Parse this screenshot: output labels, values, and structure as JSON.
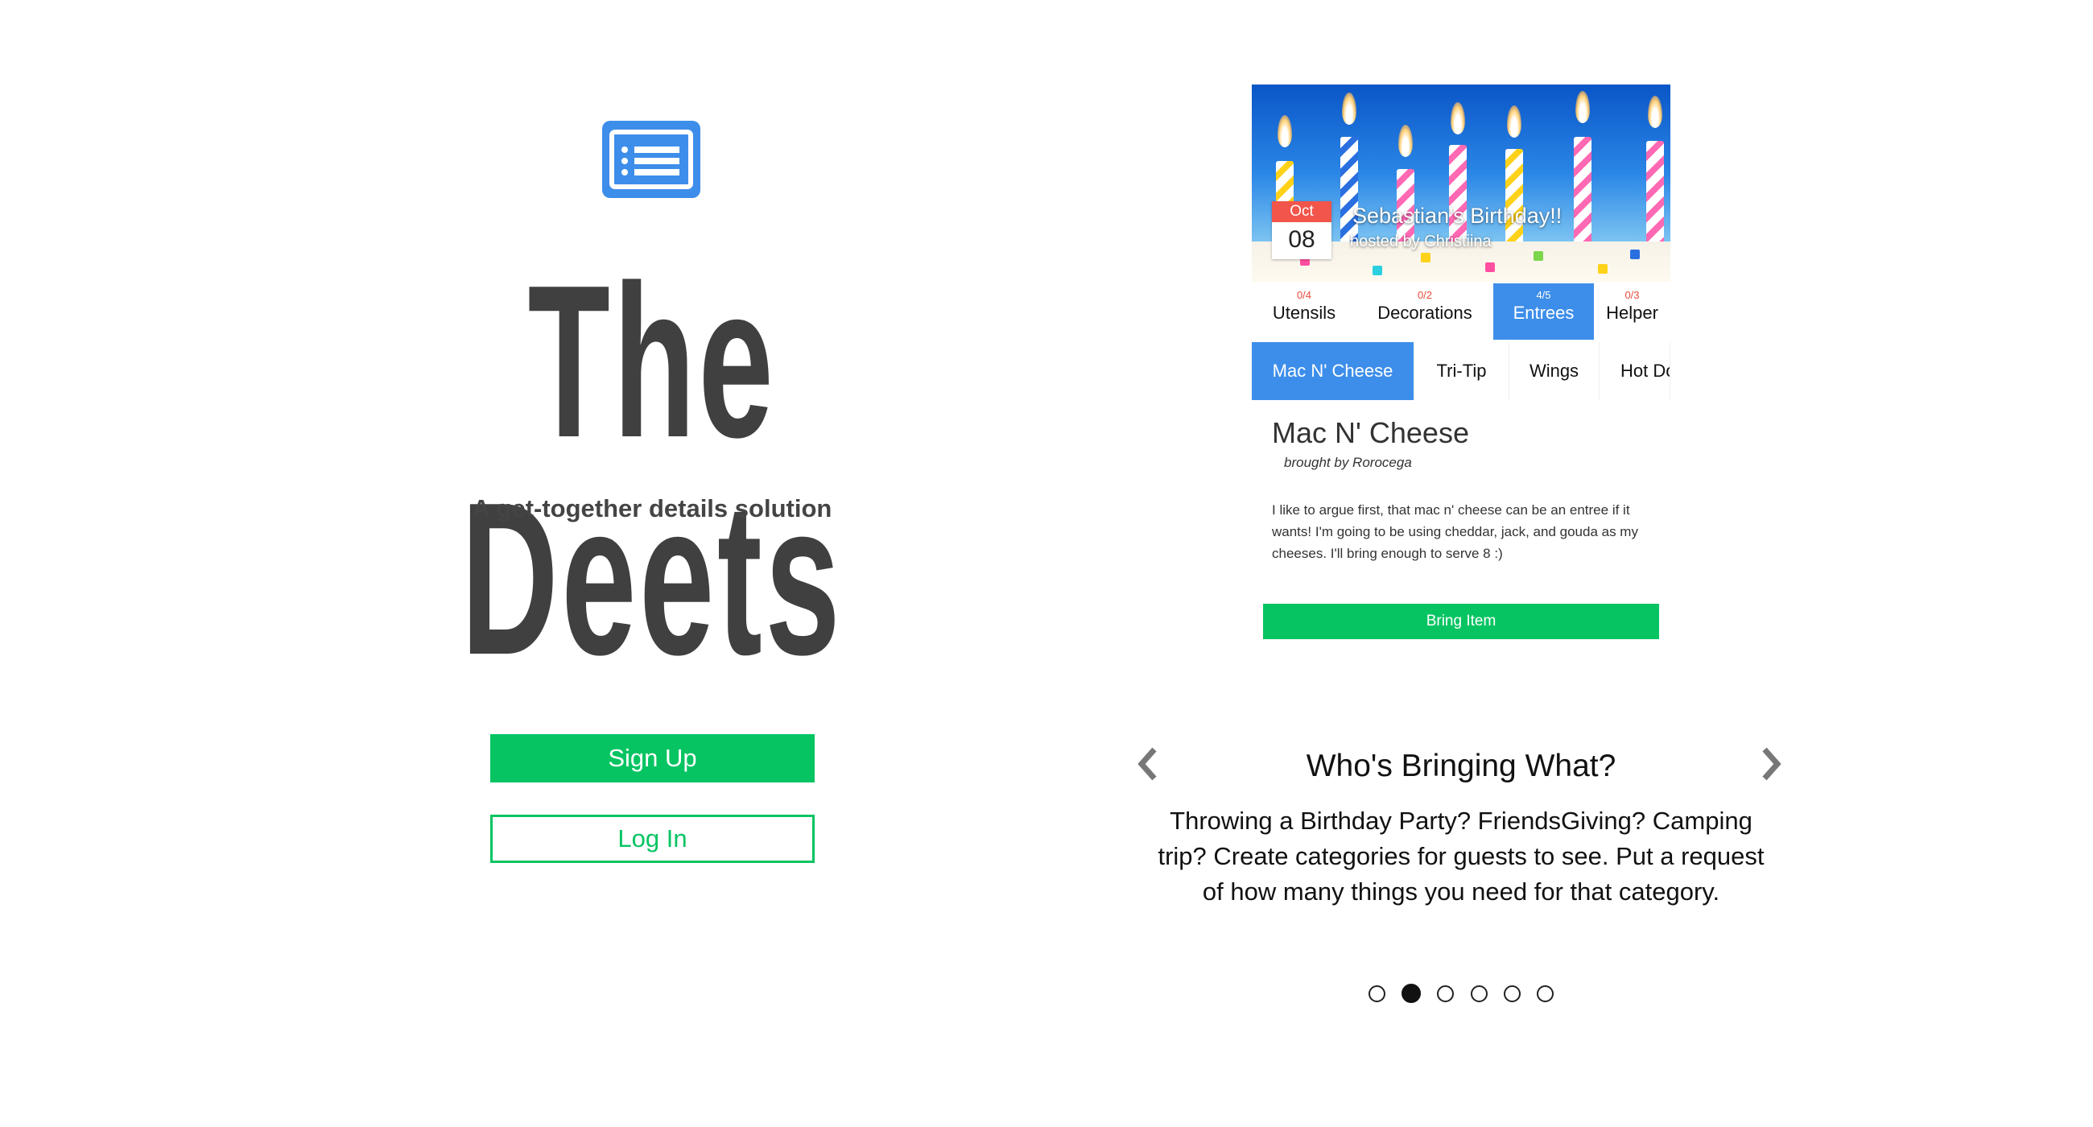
{
  "brand": {
    "icon": "list-icon",
    "title": "The Deets",
    "tagline": "A get-together details solution"
  },
  "auth": {
    "signup_label": "Sign Up",
    "login_label": "Log In"
  },
  "preview": {
    "event": {
      "month": "Oct",
      "day": "08",
      "title": "Sebastian's Birthday!!",
      "host": "hosted by Christiina"
    },
    "categories": [
      {
        "count": "0/4",
        "label": "Utensils"
      },
      {
        "count": "0/2",
        "label": "Decorations"
      },
      {
        "count": "4/5",
        "label": "Entrees",
        "active": true
      },
      {
        "count": "0/3",
        "label": "Helper"
      }
    ],
    "items": [
      {
        "label": "Mac N' Cheese",
        "active": true
      },
      {
        "label": "Tri-Tip"
      },
      {
        "label": "Wings"
      },
      {
        "label": "Hot Do"
      }
    ],
    "detail": {
      "name": "Mac N' Cheese",
      "brought_by": "brought by Rorocega",
      "description": "I like to argue first, that mac n' cheese can be an entree if it wants! I'm going to be using cheddar, jack, and gouda as my cheeses. I'll bring enough to serve 8 :)",
      "button": "Bring Item"
    }
  },
  "carousel": {
    "title": "Who's Bringing What?",
    "text": "Throwing a Birthday Party? FriendsGiving? Camping trip? Create categories for guests to see. Put a request of how many things you need for that category.",
    "prev_icon": "chevron-left-icon",
    "next_icon": "chevron-right-icon",
    "slide_count": 6,
    "active_index": 1
  },
  "colors": {
    "accent_green": "#06c462",
    "accent_blue": "#3d8eea",
    "badge_red": "#f2554a",
    "title_gray": "#404040"
  }
}
